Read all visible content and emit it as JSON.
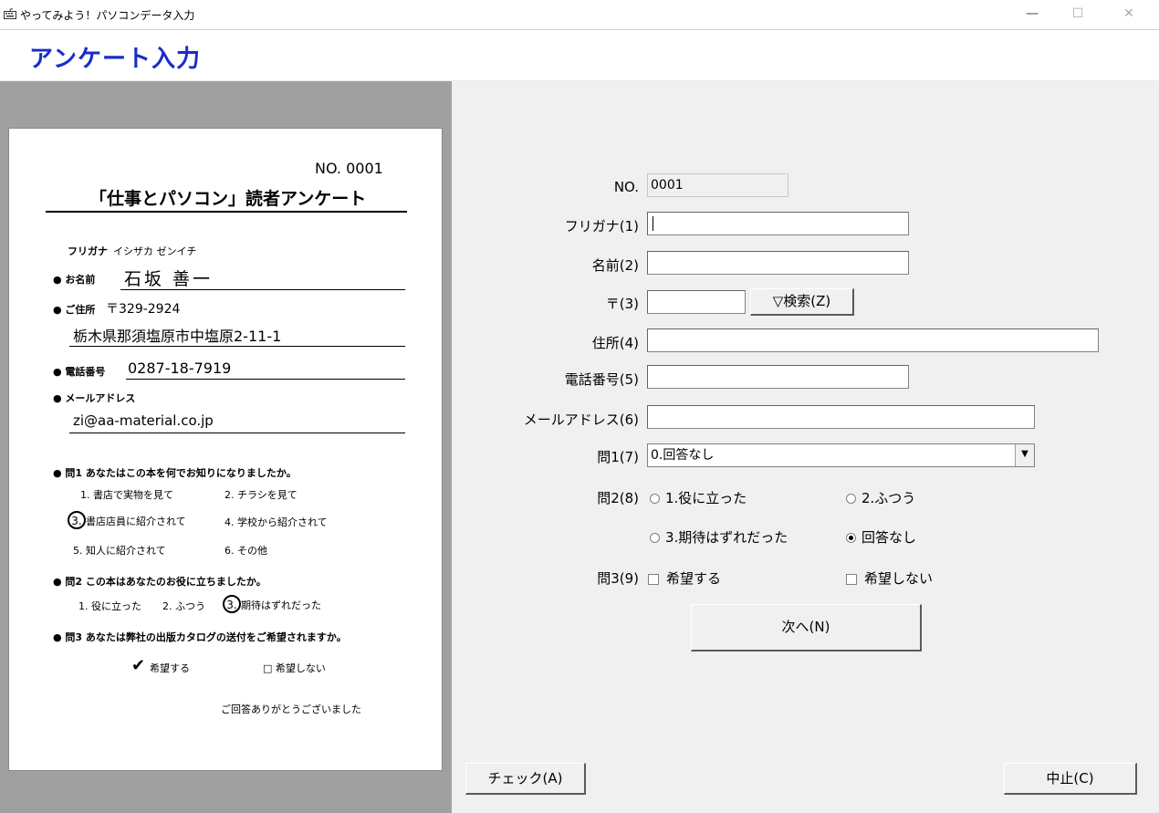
{
  "window": {
    "title": "やってみよう！パソコンデータ入力",
    "min_glyph": "—",
    "max_glyph": "☐",
    "close_glyph": "✕"
  },
  "heading": "アンケート入力",
  "paper": {
    "no": "NO. 0001",
    "title": "「仕事とパソコン」読者アンケート",
    "furigana_label": "フリガナ",
    "furigana_value": "イシザカ ゼンイチ",
    "name_label": "● お名前",
    "name_value": "石坂 善一",
    "address_label": "● ご住所",
    "postal": "〒329-2924",
    "address_value": "栃木県那須塩原市中塩原2-11-1",
    "phone_label": "● 電話番号",
    "phone_value": "0287-18-7919",
    "email_label": "● メールアドレス",
    "email_value": "zi@aa-material.co.jp",
    "q1": "● 問1 あなたはこの本を何でお知りになりましたか。",
    "q1_o1": "1. 書店で実物を見て",
    "q1_o2": "2. チラシを見て",
    "q1_o3_num": "3.",
    "q1_o3": "書店店員に紹介されて",
    "q1_o4": "4. 学校から紹介されて",
    "q1_o5": "5. 知人に紹介されて",
    "q1_o6": "6. その他",
    "q2": "● 問2 この本はあなたのお役に立ちましたか。",
    "q2_o1": "1. 役に立った",
    "q2_o2": "2. ふつう",
    "q2_o3_num": "3.",
    "q2_o3": "期待はずれだった",
    "q3": "● 問3 あなたは弊社の出版カタログの送付をご希望されますか。",
    "q3_yes_mark": "✔",
    "q3_yes": "希望する",
    "q3_no": "□ 希望しない",
    "thanks": "ご回答ありがとうございました"
  },
  "form": {
    "no_label": "NO.",
    "no_value": "0001",
    "furigana_label": "フリガナ(1)",
    "furigana_value": "",
    "name_label": "名前(2)",
    "name_value": "",
    "postal_label": "〒(3)",
    "postal_value": "",
    "search_button": "▽検索(Z)",
    "address_label": "住所(4)",
    "address_value": "",
    "phone_label": "電話番号(5)",
    "phone_value": "",
    "email_label": "メールアドレス(6)",
    "email_value": "",
    "q1_label": "問1(7)",
    "q1_selected": "0.回答なし",
    "q1_arrow": "▼",
    "q2_label": "問2(8)",
    "q2_options": [
      "1.役に立った",
      "2.ふつう",
      "3.期待はずれだった",
      "回答なし"
    ],
    "q2_selected_index": 3,
    "q3_label": "問3(9)",
    "q3_options": [
      "希望する",
      "希望しない"
    ],
    "next_button": "次へ(N)",
    "check_button": "チェック(A)",
    "cancel_button": "中止(C)"
  }
}
